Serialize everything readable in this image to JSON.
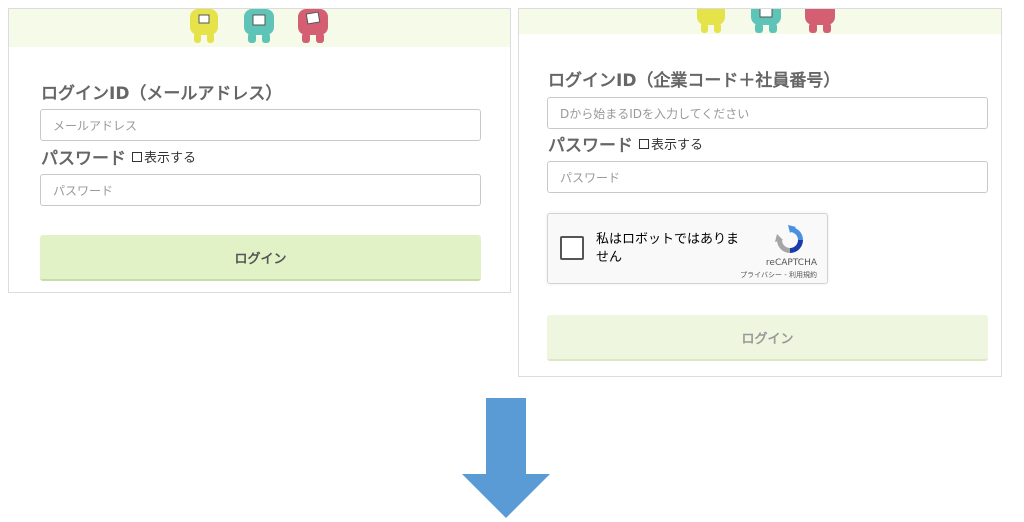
{
  "login_email": {
    "id_label": "ログインID（メールアドレス）",
    "id_placeholder": "メールアドレス",
    "password_label": "パスワード",
    "show_label": "表示する",
    "password_placeholder": "パスワード",
    "login_button": "ログイン"
  },
  "login_company": {
    "id_label": "ログインID（企業コード＋社員番号）",
    "id_placeholder": "Dから始まるIDを入力してください",
    "password_label": "パスワード",
    "show_label": "表示する",
    "password_placeholder": "パスワード",
    "recaptcha": {
      "checkbox_text": "私はロボットではありません",
      "brand": "reCAPTCHA",
      "links": "プライバシー - 利用規約"
    },
    "login_button": "ログイン"
  },
  "colors": {
    "button_bg": "#e1f2c6",
    "banner_bg": "#f5fbe8",
    "arrow": "#5b9bd5"
  },
  "icons": {
    "mascots": "mascot-characters-image",
    "recaptcha_logo": "recaptcha-logo-icon",
    "arrow": "down-arrow-icon"
  }
}
